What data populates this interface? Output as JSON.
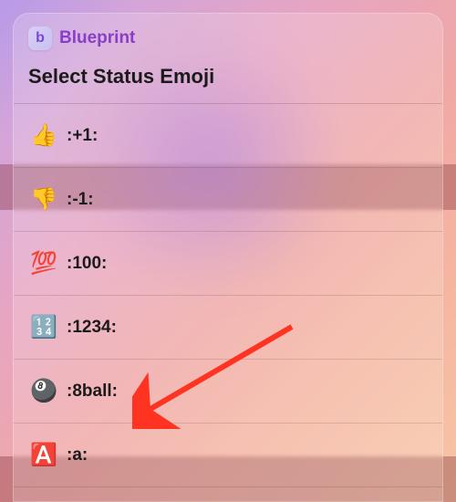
{
  "app": {
    "icon_letter": "b",
    "name": "Blueprint"
  },
  "title": "Select Status Emoji",
  "items": [
    {
      "emoji": "👍",
      "code": ":+1:"
    },
    {
      "emoji": "👎",
      "code": ":-1:"
    },
    {
      "emoji": "💯",
      "code": ":100:"
    },
    {
      "emoji": "🔢",
      "code": ":1234:"
    },
    {
      "emoji": "🎱",
      "code": ":8ball:"
    },
    {
      "emoji": "🅰️",
      "code": ":a:"
    }
  ],
  "annotation": {
    "arrow_color": "#ff3322",
    "target_item_index": 4
  }
}
